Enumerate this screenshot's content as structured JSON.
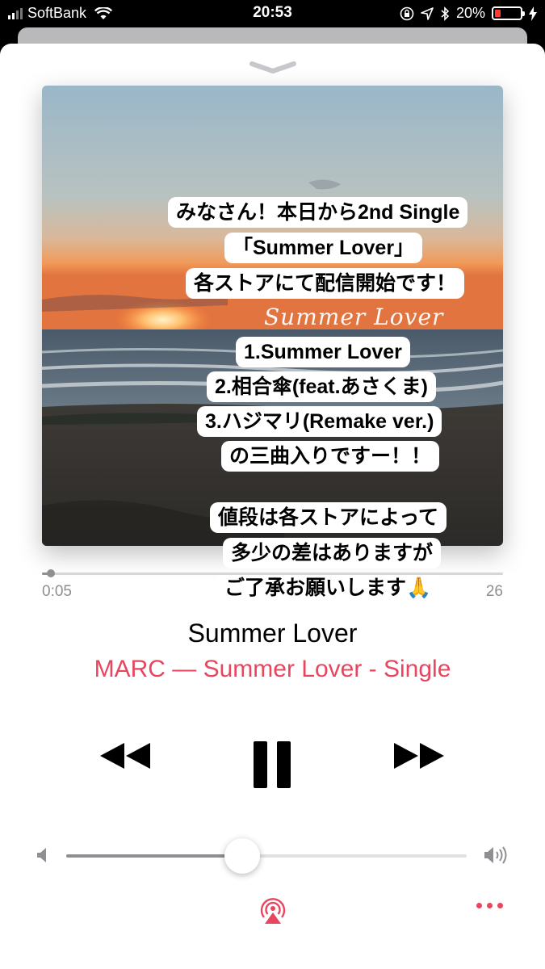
{
  "status_bar": {
    "carrier": "SoftBank",
    "time": "20:53",
    "battery_percent": "20%",
    "battery_color": "#ff3b30"
  },
  "artwork": {
    "script_title": "Summer Lover",
    "captions": [
      "みなさん！本日から2nd Single",
      "「Summer  Lover」",
      "各ストアにて配信開始です！",
      "1.Summer  Lover",
      "2.相合傘(feat.あさくま)",
      "3.ハジマリ(Remake ver.)",
      "の三曲入りですー！！",
      "値段は各ストアによって",
      "多少の差はありますが",
      "ご了承お願いします🙏"
    ]
  },
  "playback": {
    "elapsed": "0:05",
    "remaining_partial": "26",
    "progress_fraction": 0.02
  },
  "track": {
    "title": "Summer Lover",
    "subtitle": "MARC — Summer Lover - Single"
  },
  "volume": {
    "level_fraction": 0.44
  },
  "icons": {
    "grabber": "chevron-down-icon",
    "prev": "rewind-icon",
    "play": "pause-icon",
    "next": "fast-forward-icon",
    "vol_min": "speaker-low-icon",
    "vol_max": "speaker-high-icon",
    "output": "airplay-icon",
    "more": "more-icon"
  },
  "colors": {
    "accent": "#e8465f",
    "text": "#000000",
    "secondary": "#8e8e93"
  }
}
